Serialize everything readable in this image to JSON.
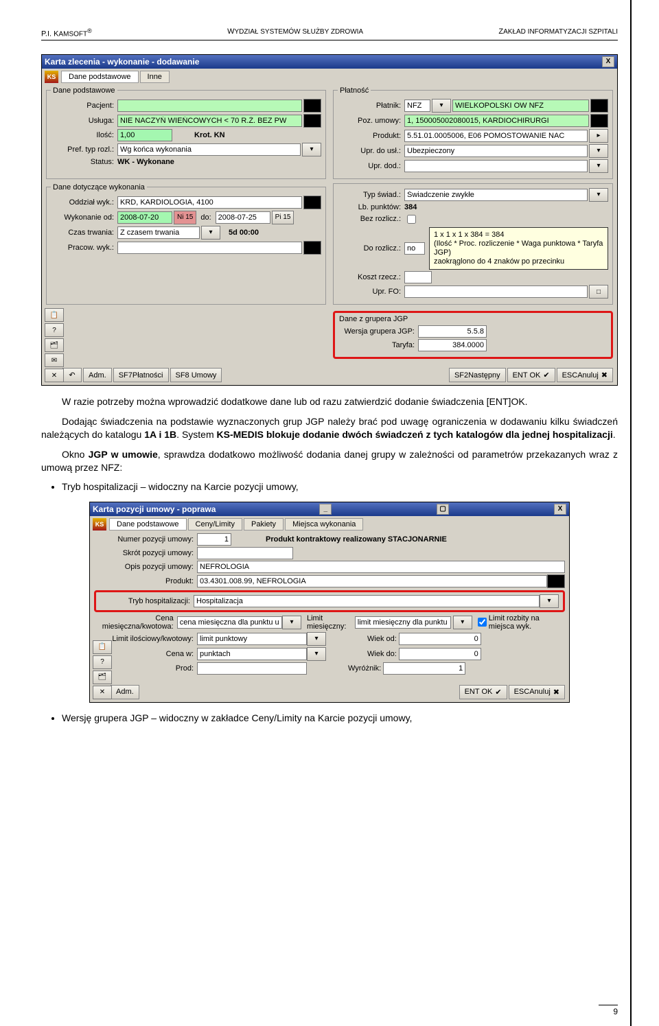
{
  "doc_header": {
    "left_prefix": "P.I. K",
    "left_name": "AMSOFT",
    "left_tm": "®",
    "center_prefix": "W",
    "center_text": "YDZIAŁ SYSTEMÓW SŁUŻBY ZDROWIA",
    "right_prefix": "Z",
    "right_text": "AKŁAD INFORMATYZACJI SZPITALI"
  },
  "dialog1": {
    "title": "Karta zlecenia - wykonanie - dodawanie",
    "close": "X",
    "logo_text": "KS",
    "tab_active": "Dane podstawowe",
    "tab_inactive": "Inne",
    "left_group_title": "Dane podstawowe",
    "right_group_title": "Płatność",
    "pacjent_label": "Pacjent:",
    "pacjent_value": " ",
    "usluga_label": "Usługa:",
    "usluga_value": "NIE NACZYŃ WIEŃCOWYCH < 70 R.Ż. BEZ PW",
    "ilosc_label": "Ilość:",
    "ilosc_value": "1,00",
    "krot_label": "Krot. KN",
    "pref_label": "Pref. typ rozl.:",
    "pref_value": "Wg końca wykonania",
    "status_label": "Status:",
    "status_value": "WK - Wykonane",
    "platnik_label": "Płatnik:",
    "platnik_code": "NFZ",
    "platnik_value": "WIELKOPOLSKI OW NFZ",
    "poz_umowy_label": "Poz. umowy:",
    "poz_umowy_value": "1, 150005002080015, KARDIOCHIRURGI",
    "produkt_label": "Produkt:",
    "produkt_value": "5.51.01.0005006, E06 POMOSTOWANIE NAC",
    "upr_label": "Upr. do usł.:",
    "upr_value": "Ubezpieczony",
    "upr_dod_label": "Upr. dod.:",
    "group_wyk_title": "Dane dotyczące wykonania",
    "oddzial_label": "Oddział wyk.:",
    "oddzial_value": "KRD, KARDIOLOGIA, 4100",
    "wyk_od_label": "Wykonanie od:",
    "wyk_od_value": "2008-07-20",
    "wyk_od_btn": "Ni  15",
    "wyk_do_label": "do:",
    "wyk_do_value": "2008-07-25",
    "wyk_do_btn": "Pi  15",
    "czas_label": "Czas trwania:",
    "czas_value": "Z czasem trwania",
    "czas_dur": "5d 00:00",
    "pracow_label": "Pracow. wyk.:",
    "pracow_value": "  ",
    "typ_swiad_label": "Typ świad.:",
    "typ_swiad_value": "Świadczenie zwykłe",
    "lb_pkt_label": "Lb. punktów:",
    "lb_pkt_value": "384",
    "bez_rozlicz_label": "Bez rozlicz.:",
    "do_rozlicz_label": "Do rozlicz.:",
    "do_rozlicz_value": "no",
    "koszt_label": "Koszt rzecz.:",
    "upr_fo_label": "Upr. FO:",
    "tooltip_l1": "1 x 1 x 1 x 384 = 384",
    "tooltip_l2": "(Ilość * Proc. rozliczenie * Waga punktowa * Taryfa JGP)",
    "tooltip_l3": "zaokrąglono do 4 znaków po przecinku",
    "jgp_group_title": "Dane z grupera JGP",
    "wersja_label": "Wersja grupera JGP:",
    "wersja_value": "5.5.8",
    "taryfa_label": "Taryfa:",
    "taryfa_value": "384.0000",
    "foot_adm": "Adm.",
    "foot_sf7": "SF7Płatności",
    "foot_sf8": "SF8 Umowy",
    "foot_sf2": "SF2Następny",
    "foot_ent": "ENT OK",
    "foot_esc": "ESCAnuluj"
  },
  "para1": "W razie potrzeby można wprowadzić dodatkowe dane lub od razu zatwierdzić dodanie świadczenia [ENT]OK.",
  "para2a": "Dodając świadczenia na podstawie wyznaczonych grup JGP należy brać pod uwagę ograniczenia w dodawaniu kilku świadczeń należących do katalogu ",
  "para2b": "1A i 1B",
  "para2c": ". System ",
  "para2d": "KS-MEDIS blokuje dodanie dwóch świadczeń z tych katalogów dla jednej hospitalizacji",
  "para2e": ".",
  "para3a": "Okno ",
  "para3b": "JGP w umowie",
  "para3c": ", sprawdza dodatkowo możliwość dodania danej grupy w zależności od parametrów przekazanych wraz z umową przez NFZ:",
  "bullet1": "Tryb hospitalizacji – widoczny na Karcie pozycji umowy,",
  "bullet2": "Wersję grupera JGP – widoczny w zakładce Ceny/Limity na Karcie pozycji umowy,",
  "dialog2": {
    "title": "Karta pozycji umowy - poprawa",
    "close": "X",
    "logo_text": "KS",
    "tab1": "Dane podstawowe",
    "tab2": "Ceny/Limity",
    "tab3": "Pakiety",
    "tab4": "Miejsca wykonania",
    "numer_label": "Numer pozycji umowy:",
    "numer_value": "1",
    "heading_right": "Produkt kontraktowy realizowany STACJONARNIE",
    "skrot_label": "Skrót pozycji umowy:",
    "skrot_value": "",
    "opis_label": "Opis pozycji umowy:",
    "opis_value": "NEFROLOGIA",
    "produkt_label": "Produkt:",
    "produkt_value": "03.4301.008.99, NEFROLOGIA",
    "tryb_label": "Tryb hospitalizacji:",
    "tryb_value": "Hospitalizacja",
    "cena_mies_label": "Cena miesięczna/kwotowa:",
    "cena_mies_value": "cena miesięczna dla punktu umowy",
    "limit_mies_label": "Limit miesięczny:",
    "limit_mies_value": "limit miesięczny dla punktu",
    "limit_rozb_label": "Limit rozbity na miejsca wyk.",
    "limit_il_label": "Limit ilościowy/kwotowy:",
    "limit_il_value": "limit punktowy",
    "wiek_od_label": "Wiek od:",
    "wiek_od_value": "0",
    "cena_w_label": "Cena w:",
    "cena_w_value": "punktach",
    "wiek_do_label": "Wiek do:",
    "wiek_do_value": "0",
    "prod_label": "Prod:",
    "prod_value": "",
    "wyroznik_label": "Wyróżnik:",
    "wyroznik_value": "1",
    "foot_adm": "Adm.",
    "foot_ent": "ENT OK",
    "foot_esc": "ESCAnuluj"
  },
  "page_number": "9"
}
